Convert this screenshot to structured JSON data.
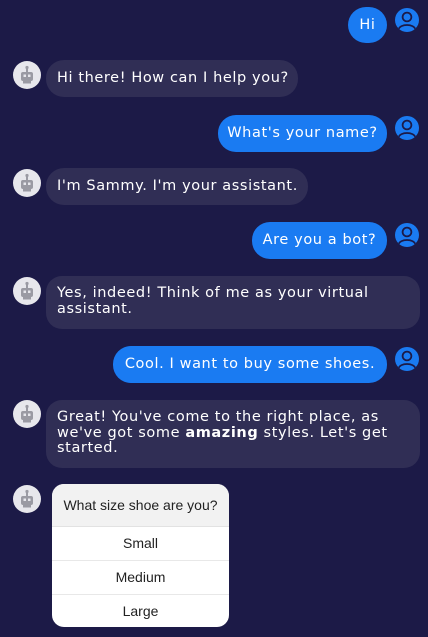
{
  "messages": [
    {
      "from": "user",
      "text": "Hi"
    },
    {
      "from": "bot",
      "text": "Hi there! How can I help you?"
    },
    {
      "from": "user",
      "text": "What's your name?"
    },
    {
      "from": "bot",
      "text": "I'm Sammy. I'm your assistant."
    },
    {
      "from": "user",
      "text": "Are you a bot?"
    },
    {
      "from": "bot",
      "text": "Yes, indeed! Think of me as your virtual assistant."
    },
    {
      "from": "user",
      "text": "Cool. I want to buy some shoes."
    },
    {
      "from": "bot",
      "text_before": "Great! You've come to the right place, as we've got some ",
      "text_bold": "amazing",
      "text_after": " styles. Let's get started."
    }
  ],
  "size_prompt": {
    "question": "What size shoe are you?",
    "options": [
      "Small",
      "Medium",
      "Large"
    ]
  },
  "colors": {
    "background": "#1c1a47",
    "user_bubble": "#1a7bf2",
    "bot_bubble": "#302e55",
    "card_bg": "#ffffff"
  },
  "icons": {
    "user_avatar": "user-avatar-icon",
    "bot_avatar": "robot-avatar-icon"
  }
}
